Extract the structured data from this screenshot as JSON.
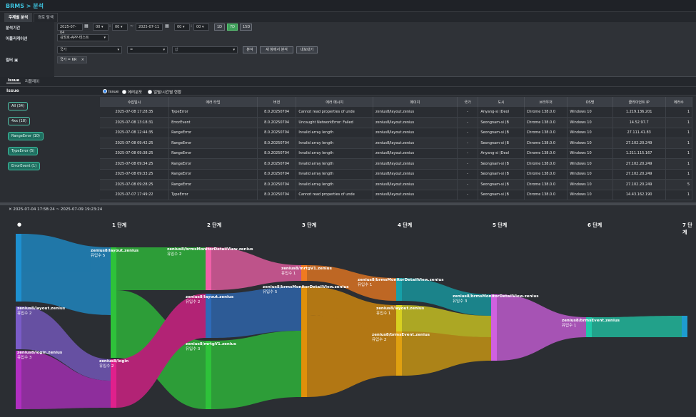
{
  "header": {
    "title": "BRMS > 분석"
  },
  "tabs": [
    "주제별 분석",
    "경로 탐색"
  ],
  "filter": {
    "period_label": "분석기간",
    "start_date": "2025-07-04",
    "start_hour": "00",
    "start_min": "00",
    "tilde": "~",
    "end_date": "2025-07-11",
    "end_hour": "00",
    "end_min": "00",
    "quick": [
      "1D",
      "7D",
      "15D"
    ],
    "app_label": "어플리케이션",
    "app_value": "김범호-APP-테스트",
    "filter_label": "필터",
    "field_value": "국가",
    "op_value": "=",
    "val_placeholder": "값",
    "buttons": [
      "분석",
      "새 창에서 분석",
      "내보내기"
    ],
    "chip": "국가 = KR",
    "chip_close": "×"
  },
  "subtabs": [
    "Issue",
    "리플레이"
  ],
  "issue": {
    "header": "Issue",
    "pills": [
      {
        "label": "All (34)"
      },
      {
        "label": "4xx (18)"
      },
      {
        "label": "RangeError (10)"
      },
      {
        "label": "TypeError (5)"
      },
      {
        "label": "ErrorEvent (1)"
      }
    ]
  },
  "radios": [
    "Issue",
    "에러분포",
    "일별/시간별 현황"
  ],
  "table": {
    "columns": [
      "수집일시",
      "에러 타입",
      "버전",
      "에러 메시지",
      "페이지",
      "국가",
      "도시",
      "브라우저",
      "OS명",
      "클라이언트 IP",
      "에러수"
    ],
    "rows": [
      [
        "2025-07-08 17:28:35",
        "TypeError",
        "8.0.20250704",
        "Cannot read properties of unde",
        "zenius8/layout.zenius",
        "-",
        "Anyang-si (Deol",
        "Chrome 138.0.0",
        "Windows 10",
        "1.219.136.201",
        "1"
      ],
      [
        "2025-07-08 13:18:31",
        "ErrorEvent",
        "8.0.20250704",
        "Uncaught NetworkError: Failed",
        "zenius8/layout.zenius",
        "-",
        "Seongnam-si (B",
        "Chrome 138.0.0",
        "Windows 10",
        "14.52.97.7",
        "1"
      ],
      [
        "2025-07-08 12:44:35",
        "RangeError",
        "8.0.20250704",
        "Invalid array length",
        "zenius8/layout.zenius",
        "-",
        "Seongnam-si (B",
        "Chrome 138.0.0",
        "Windows 10",
        "27.111.41.83",
        "1"
      ],
      [
        "2025-07-08 09:42:25",
        "RangeError",
        "8.0.20250704",
        "Invalid array length",
        "zenius8/layout.zenius",
        "-",
        "Seongnam-si (B",
        "Chrome 138.0.0",
        "Windows 10",
        "27.102.20.249",
        "1"
      ],
      [
        "2025-07-08 09:38:25",
        "RangeError",
        "8.0.20250704",
        "Invalid array length",
        "zenius8/layout.zenius",
        "-",
        "Anyang-si (Deol",
        "Chrome 138.0.0",
        "Windows 10",
        "1.211.115.167",
        "1"
      ],
      [
        "2025-07-08 09:34:25",
        "RangeError",
        "8.0.20250704",
        "Invalid array length",
        "zenius8/layout.zenius",
        "-",
        "Seongnam-si (B",
        "Chrome 138.0.0",
        "Windows 10",
        "27.102.20.249",
        "1"
      ],
      [
        "2025-07-08 09:33:25",
        "RangeError",
        "8.0.20250704",
        "Invalid array length",
        "zenius8/layout.zenius",
        "-",
        "Seongnam-si (B",
        "Chrome 138.0.0",
        "Windows 10",
        "27.102.20.249",
        "1"
      ],
      [
        "2025-07-08 09:28:25",
        "RangeError",
        "8.0.20250704",
        "Invalid array length",
        "zenius8/layout.zenius",
        "-",
        "Seongnam-si (B",
        "Chrome 138.0.0",
        "Windows 10",
        "27.102.20.249",
        "5"
      ],
      [
        "2025-07-07 17:49:22",
        "TypeError",
        "8.0.20250704",
        "Cannot read properties of unde",
        "zenius8/layout.zenius",
        "-",
        "Seongnam-si (B",
        "Chrome 138.0.0",
        "Windows 10",
        "14.43.162.190",
        "1"
      ]
    ]
  },
  "path": {
    "range": "2025-07-04 17:58:24 ~ 2025-07-09 19:23:24",
    "range_icon": "✕",
    "start_dot": "●",
    "stages": [
      "1 단계",
      "2 단계",
      "3 단계",
      "4 단계",
      "5 단계",
      "6 단계",
      "7 단계"
    ],
    "inflow_label": "유입수",
    "nodes": [
      {
        "name": "zenius8/layout.zenius",
        "count": "유입수 5",
        "color": "#2ec23a"
      },
      {
        "name": "zenius8/layout.zenius",
        "count": "유입수 2",
        "color": "#7a5cc8"
      },
      {
        "name": "zenius8/login.zenius",
        "count": "유입수 3",
        "color": "#b02fc0"
      },
      {
        "name": "zenius8/login",
        "count": "유입수 2",
        "color": "#e0208c"
      },
      {
        "name": "zenius8/brmsMonitorDetailView.zenius",
        "count": "유입수 2",
        "color": "#f060a8"
      },
      {
        "name": "zenius8/layout.zenius",
        "count": "유입수 2",
        "color": "#2e6ab8"
      },
      {
        "name": "zenius8/mrtgV1.zenius",
        "count": "유입수 3",
        "color": "#2ec23a"
      },
      {
        "name": "zenius8/mrtgV1.zenius",
        "count": "유입수 1",
        "color": "#f07a20"
      },
      {
        "name": "zenius8/brmsMonitorDetailView.zenius",
        "count": "유입수 5",
        "color": "#e0900a"
      },
      {
        "name": "zenius8/brmsMonitorDetailView.zenius",
        "count": "유입수 1",
        "color": "#16a0a8"
      },
      {
        "name": "zenius8/layout.zenius",
        "count": "유입수 1",
        "color": "#d8d020"
      },
      {
        "name": "zenius8/brmsEvent.zenius",
        "count": "유입수 2",
        "color": "#e0a010"
      },
      {
        "name": "zenius8/brmsMonitorDetailView.zenius",
        "count": "유입수 3",
        "color": "#d060e0"
      },
      {
        "name": "zenius8/brmsEvent.zenius",
        "count": "유입수 1",
        "color": "#20c8a8"
      }
    ]
  }
}
